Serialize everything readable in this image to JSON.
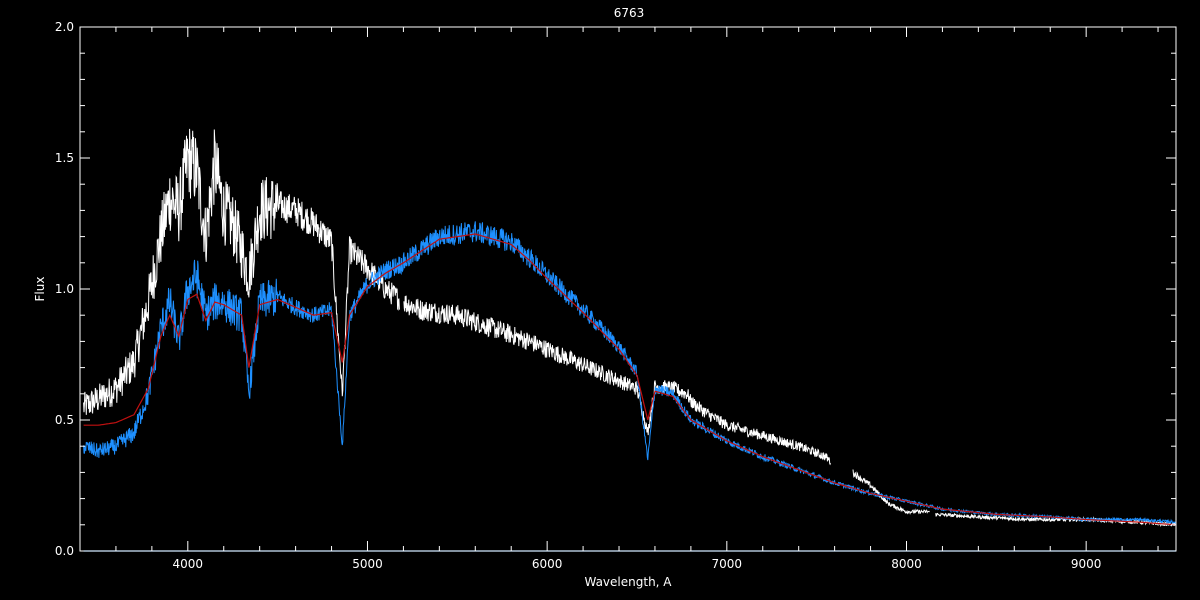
{
  "chart_data": {
    "type": "line",
    "title": "6763",
    "xlabel": "Wavelength, A",
    "ylabel": "Flux",
    "xlim": [
      3400,
      9500
    ],
    "ylim": [
      0,
      2.0
    ],
    "x_ticks": [
      4000,
      5000,
      6000,
      7000,
      8000,
      9000
    ],
    "x_tick_labels": [
      "4000",
      "5000",
      "6000",
      "7000",
      "8000",
      "9000"
    ],
    "x_minor_step": 200,
    "y_ticks": [
      0,
      0.5,
      1.0,
      1.5,
      2.0
    ],
    "y_tick_labels": [
      "0.0",
      "0.5",
      "1.0",
      "1.5",
      "2.0"
    ],
    "y_minor_step": 0.1,
    "grid": false,
    "background": "#000000",
    "series": [
      {
        "color": "#ffffff",
        "noise": 0.045,
        "gaps": [
          [
            5180,
            5200
          ],
          [
            7580,
            7700
          ],
          [
            8130,
            8160
          ]
        ],
        "x": [
          3420,
          3500,
          3600,
          3700,
          3780,
          3850,
          3900,
          3950,
          4000,
          4050,
          4100,
          4150,
          4200,
          4250,
          4300,
          4340,
          4400,
          4500,
          4600,
          4700,
          4800,
          4860,
          4900,
          5000,
          5100,
          5200,
          5300,
          5500,
          5700,
          5900,
          6100,
          6300,
          6500,
          6560,
          6600,
          6700,
          6780,
          6800,
          6900,
          7000,
          7200,
          7400,
          7550,
          7580,
          7700,
          7800,
          7900,
          8000,
          8100,
          8130,
          8160,
          8400,
          8700,
          9000,
          9300,
          9500
        ],
        "y": [
          0.55,
          0.58,
          0.62,
          0.72,
          0.95,
          1.2,
          1.35,
          1.3,
          1.5,
          1.45,
          1.2,
          1.48,
          1.3,
          1.25,
          1.15,
          1.05,
          1.3,
          1.32,
          1.3,
          1.25,
          1.18,
          0.6,
          1.15,
          1.08,
          1.0,
          0.95,
          0.92,
          0.9,
          0.85,
          0.8,
          0.74,
          0.68,
          0.62,
          0.45,
          0.63,
          0.62,
          0.6,
          0.57,
          0.52,
          0.48,
          0.44,
          0.4,
          0.36,
          0.34,
          0.3,
          0.25,
          0.18,
          0.15,
          0.15,
          0.15,
          0.14,
          0.13,
          0.12,
          0.12,
          0.11,
          0.1
        ]
      },
      {
        "color": "#1e90ff",
        "noise": 0.035,
        "gaps": [],
        "x": [
          3420,
          3500,
          3600,
          3700,
          3780,
          3850,
          3900,
          3950,
          4000,
          4050,
          4100,
          4150,
          4200,
          4250,
          4300,
          4340,
          4400,
          4500,
          4600,
          4700,
          4800,
          4860,
          4900,
          5000,
          5100,
          5200,
          5400,
          5600,
          5800,
          5900,
          6000,
          6200,
          6400,
          6500,
          6560,
          6600,
          6700,
          6800,
          7000,
          7200,
          7400,
          7600,
          7800,
          8000,
          8200,
          8500,
          8800,
          9000,
          9300,
          9500
        ],
        "y": [
          0.4,
          0.38,
          0.4,
          0.45,
          0.6,
          0.85,
          0.95,
          0.8,
          1.0,
          1.05,
          0.9,
          0.95,
          0.95,
          0.92,
          0.9,
          0.6,
          0.95,
          0.97,
          0.93,
          0.9,
          0.92,
          0.4,
          0.9,
          1.02,
          1.07,
          1.1,
          1.2,
          1.22,
          1.18,
          1.12,
          1.05,
          0.92,
          0.78,
          0.68,
          0.35,
          0.62,
          0.6,
          0.5,
          0.42,
          0.36,
          0.31,
          0.26,
          0.22,
          0.19,
          0.16,
          0.14,
          0.13,
          0.12,
          0.12,
          0.11
        ]
      },
      {
        "color": "#c01010",
        "noise": 0.0,
        "gaps": [],
        "x": [
          3420,
          3500,
          3600,
          3700,
          3780,
          3850,
          3900,
          3950,
          4000,
          4050,
          4100,
          4150,
          4200,
          4250,
          4300,
          4340,
          4400,
          4500,
          4600,
          4700,
          4800,
          4860,
          4900,
          5000,
          5100,
          5200,
          5400,
          5600,
          5800,
          5900,
          6000,
          6200,
          6400,
          6500,
          6560,
          6600,
          6700,
          6800,
          7000,
          7200,
          7400,
          7600,
          7800,
          8000,
          8200,
          8500,
          8800,
          9000,
          9300,
          9500
        ],
        "y": [
          0.48,
          0.48,
          0.49,
          0.52,
          0.62,
          0.82,
          0.9,
          0.82,
          0.96,
          0.98,
          0.88,
          0.95,
          0.94,
          0.92,
          0.9,
          0.7,
          0.94,
          0.96,
          0.93,
          0.9,
          0.91,
          0.72,
          0.9,
          1.01,
          1.06,
          1.1,
          1.19,
          1.21,
          1.17,
          1.11,
          1.04,
          0.91,
          0.77,
          0.67,
          0.5,
          0.61,
          0.59,
          0.5,
          0.42,
          0.36,
          0.31,
          0.26,
          0.22,
          0.19,
          0.16,
          0.14,
          0.13,
          0.12,
          0.11,
          0.1
        ]
      },
      {
        "color": "#1e90ff",
        "noise": 0.0,
        "gaps": [],
        "x": [
          3420,
          9500
        ],
        "y": [
          0.0,
          0.0
        ]
      }
    ]
  }
}
